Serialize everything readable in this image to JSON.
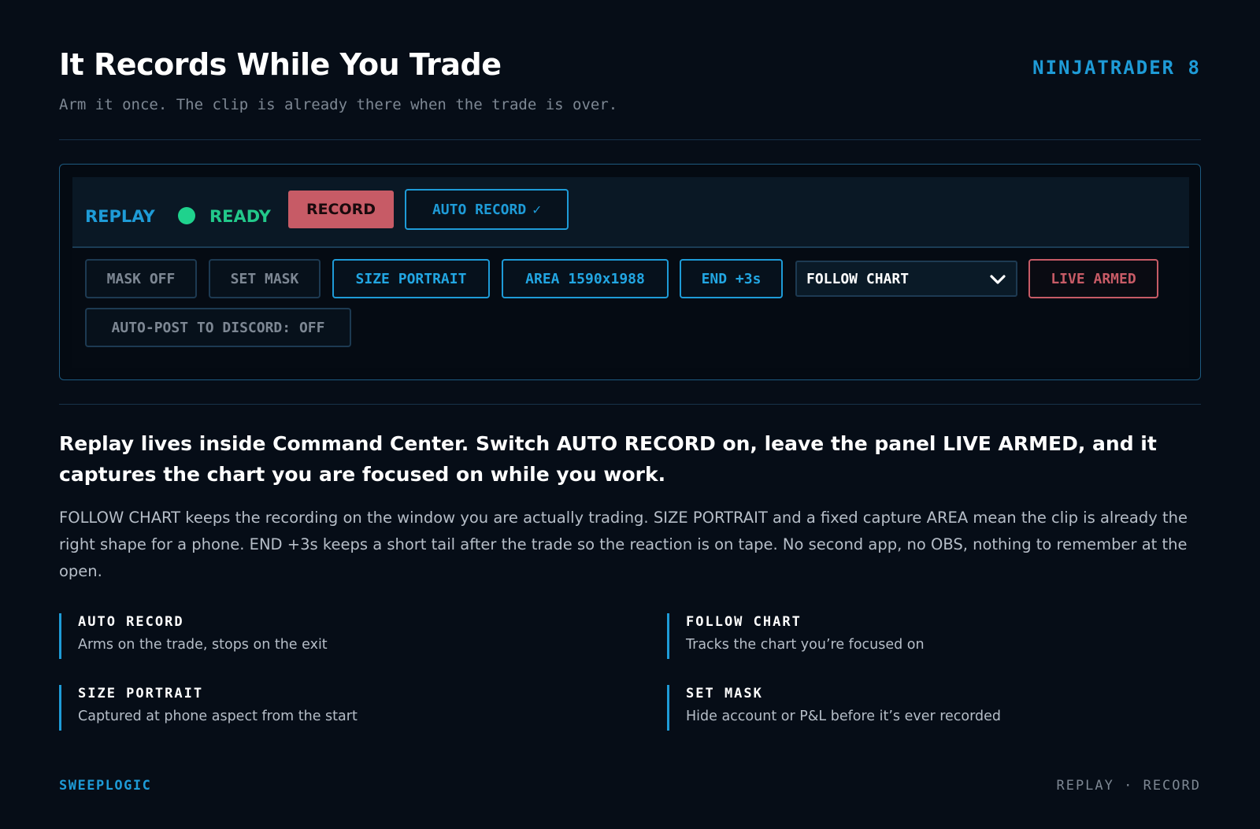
{
  "header": {
    "title": "It Records While You Trade",
    "subtitle": "Arm it once. The clip is already there when the trade is over.",
    "brand": "NINJATRADER 8"
  },
  "panel": {
    "replay_label": "REPLAY",
    "status_label": "READY",
    "status_color": "#1fd28d",
    "record_button": "RECORD",
    "auto_record_button": "AUTO RECORD",
    "auto_record_check": "✓",
    "mask_off": "MASK OFF",
    "set_mask": "SET MASK",
    "size_portrait": "SIZE PORTRAIT",
    "area": "AREA 1590x1988",
    "end": "END +3s",
    "follow_select": "FOLLOW CHART",
    "live_armed": "LIVE ARMED",
    "auto_post": "AUTO-POST TO DISCORD: OFF"
  },
  "content": {
    "lead": "Replay lives inside Command Center. Switch AUTO RECORD on, leave the panel LIVE ARMED, and it captures the chart you are focused on while you work.",
    "body": "FOLLOW CHART keeps the recording on the window you are actually trading. SIZE PORTRAIT and a fixed capture AREA mean the clip is already the right shape for a phone. END +3s keeps a short tail after the trade so the reaction is on tape. No second app, no OBS, nothing to remember at the open."
  },
  "features": [
    {
      "title": "AUTO RECORD",
      "desc": "Arms on the trade, stops on the exit"
    },
    {
      "title": "FOLLOW CHART",
      "desc": "Tracks the chart you’re focused on"
    },
    {
      "title": "SIZE PORTRAIT",
      "desc": "Captured at phone aspect from the start"
    },
    {
      "title": "SET MASK",
      "desc": "Hide account or P&L before it’s ever recorded"
    }
  ],
  "footer": {
    "brand": "SWEEPLOGIC",
    "right": "REPLAY · RECORD"
  },
  "colors": {
    "accent": "#1e9bd7",
    "record": "#c75b66",
    "ready": "#1fd28d",
    "background": "#060d17"
  }
}
